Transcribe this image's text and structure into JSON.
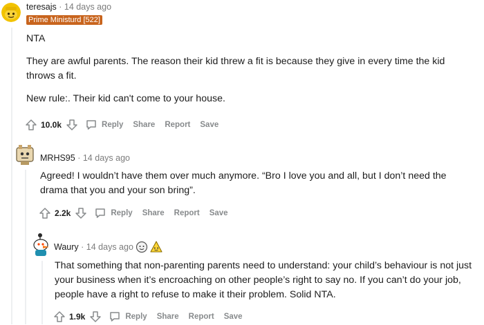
{
  "comments": [
    {
      "username": "teresajs",
      "separator": "·",
      "time": "14 days ago",
      "flair": "Prime Ministurd [522]",
      "paragraphs": [
        "NTA",
        "They are awful parents. The reason their kid threw a fit is because they give in every time the kid throws a fit.",
        "New rule:. Their kid can't come to your house."
      ],
      "score": "10.0k",
      "actions": {
        "reply": "Reply",
        "share": "Share",
        "report": "Report",
        "save": "Save"
      }
    },
    {
      "username": "MRHS95",
      "separator": "·",
      "time": "14 days ago",
      "paragraphs": [
        "Agreed! I wouldn’t have them over much anymore. “Bro I love you and all, but I don’t need the drama that you and your son bring”."
      ],
      "score": "2.2k",
      "actions": {
        "reply": "Reply",
        "share": "Share",
        "report": "Report",
        "save": "Save"
      }
    },
    {
      "username": "Waury",
      "separator": "·",
      "time": "14 days ago",
      "award_icons": [
        "face-award-icon",
        "helpful-award-icon"
      ],
      "paragraphs": [
        "That something that non-parenting parents need to understand: your child’s behaviour is not just your business when it’s encroaching on other people’s right to say no. If you can’t do your job, people have a right to refuse to make it their problem. Solid NTA."
      ],
      "score": "1.9k",
      "actions": {
        "reply": "Reply",
        "share": "Share",
        "report": "Report",
        "save": "Save"
      }
    }
  ],
  "colors": {
    "flair": "#c8641d",
    "meta": "#7c7c7c",
    "action": "#878a8c",
    "thread": "#edeff1"
  }
}
